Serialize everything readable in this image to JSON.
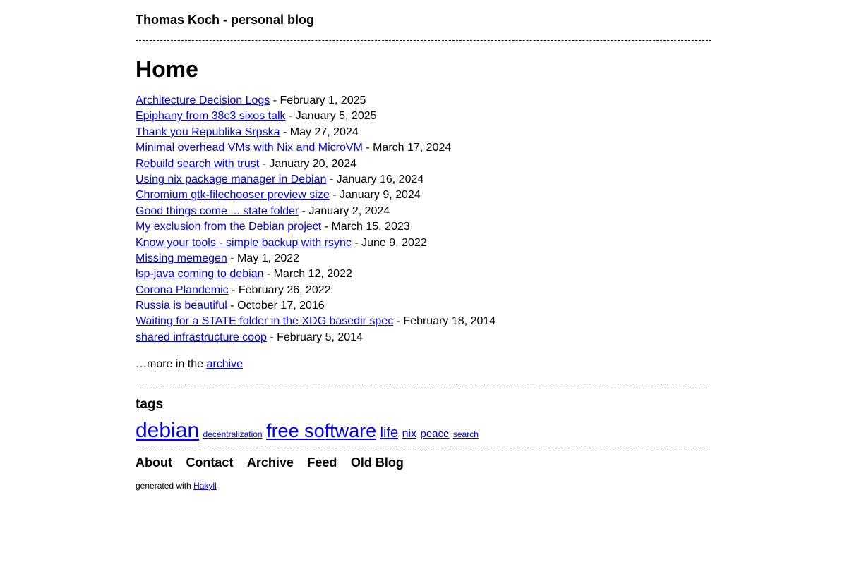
{
  "site": {
    "title": "Thomas Koch - personal blog"
  },
  "page": {
    "heading": "Home"
  },
  "posts": [
    {
      "title": "Architecture Decision Logs",
      "date": "February 1, 2025"
    },
    {
      "title": "Epiphany from 38c3 sixos talk",
      "date": "January 5, 2025"
    },
    {
      "title": "Thank you Republika Srpska",
      "date": "May 27, 2024"
    },
    {
      "title": "Minimal overhead VMs with Nix and MicroVM",
      "date": "March 17, 2024"
    },
    {
      "title": "Rebuild search with trust",
      "date": "January 20, 2024"
    },
    {
      "title": "Using nix package manager in Debian",
      "date": "January 16, 2024"
    },
    {
      "title": "Chromium gtk-filechooser preview size",
      "date": "January 9, 2024"
    },
    {
      "title": "Good things come ... state folder",
      "date": "January 2, 2024"
    },
    {
      "title": "My exclusion from the Debian project",
      "date": "March 15, 2023"
    },
    {
      "title": "Know your tools - simple backup with rsync",
      "date": "June 9, 2022"
    },
    {
      "title": "Missing memegen",
      "date": "May 1, 2022"
    },
    {
      "title": "lsp-java coming to debian",
      "date": "March 12, 2022"
    },
    {
      "title": "Corona Plandemic",
      "date": "February 26, 2022"
    },
    {
      "title": "Russia is beautiful",
      "date": "October 17, 2016"
    },
    {
      "title": "Waiting for a STATE folder in the XDG basedir spec",
      "date": "February 18, 2014"
    },
    {
      "title": "shared infrastructure coop",
      "date": "February 5, 2014"
    }
  ],
  "date_separator": " - ",
  "more": {
    "prefix": "…more in the ",
    "link": "archive"
  },
  "tags": {
    "heading": "tags",
    "items": [
      {
        "label": "debian",
        "size": "xl"
      },
      {
        "label": "decentralization",
        "size": "s"
      },
      {
        "label": "free software",
        "size": "xl"
      },
      {
        "label": "life",
        "size": "l"
      },
      {
        "label": "nix",
        "size": "m"
      },
      {
        "label": "peace",
        "size": "m"
      },
      {
        "label": "search",
        "size": "s"
      }
    ]
  },
  "footer": {
    "nav": [
      "About",
      "Contact",
      "Archive",
      "Feed",
      "Old Blog"
    ],
    "generated_prefix": "generated with ",
    "generated_link": "Hakyll"
  },
  "colors": {
    "link": "#0000ee",
    "text": "#000000",
    "background": "#ffffff"
  }
}
